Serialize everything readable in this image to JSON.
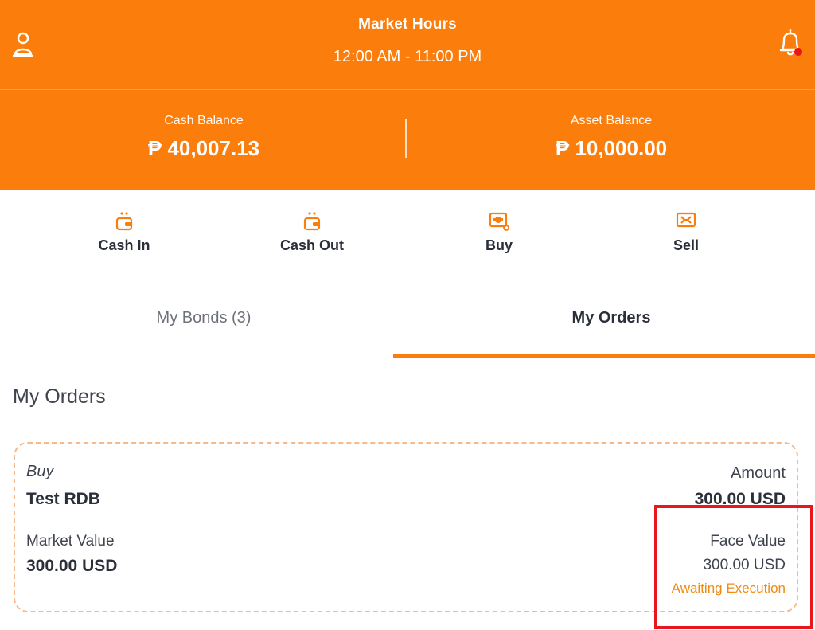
{
  "header": {
    "market_title": "Market Hours",
    "market_hours": "12:00 AM - 11:00 PM",
    "user_icon": "user-icon",
    "bell_icon": "bell-icon",
    "notification_dot_color": "#e8151b",
    "brand_color": "#fb7d0b"
  },
  "balances": {
    "cash": {
      "label": "Cash Balance",
      "value": "₱ 40,007.13"
    },
    "asset": {
      "label": "Asset Balance",
      "value": "₱ 10,000.00"
    }
  },
  "actions": [
    {
      "label": "Cash In",
      "icon": "wallet-in-icon"
    },
    {
      "label": "Cash Out",
      "icon": "wallet-out-icon"
    },
    {
      "label": "Buy",
      "icon": "buy-bond-icon"
    },
    {
      "label": "Sell",
      "icon": "sell-bond-icon"
    }
  ],
  "tabs": {
    "bonds": "My Bonds (3)",
    "orders": "My Orders",
    "active": "orders"
  },
  "orders_section": {
    "title": "My Orders",
    "orders": [
      {
        "type": "Buy",
        "name": "Test RDB",
        "market_value_label": "Market Value",
        "market_value": "300.00 USD",
        "amount_label": "Amount",
        "amount": "300.00 USD",
        "face_value_label": "Face Value",
        "face_value": "300.00 USD",
        "status": "Awaiting Execution",
        "status_color": "#f08a12"
      }
    ]
  },
  "highlight_color": "#e8161d"
}
